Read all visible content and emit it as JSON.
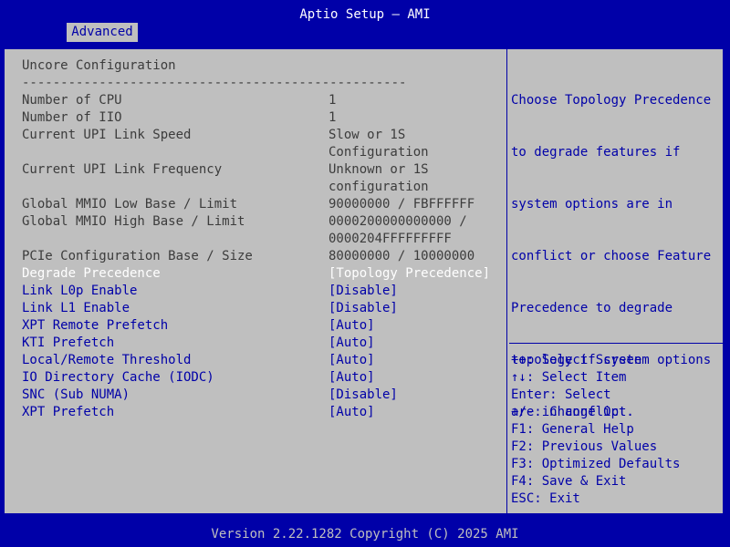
{
  "header": {
    "title": "Aptio Setup – AMI",
    "tab": "Advanced"
  },
  "section": {
    "title": "Uncore Configuration",
    "separator": "--------------------------------------------------"
  },
  "info_rows": [
    {
      "label": "Number of CPU",
      "value": "1"
    },
    {
      "label": "Number of IIO",
      "value": "1"
    },
    {
      "label": "Current UPI Link Speed",
      "value": "Slow or 1S",
      "value2": "Configuration"
    },
    {
      "label": "Current UPI Link Frequency",
      "value": "Unknown or 1S",
      "value2": "configuration"
    },
    {
      "label": "Global MMIO Low Base / Limit",
      "value": "90000000 / FBFFFFFF"
    },
    {
      "label": "Global MMIO High Base / Limit",
      "value": "0000200000000000 /",
      "value2": "0000204FFFFFFFFF"
    },
    {
      "label": "PCIe Configuration Base / Size",
      "value": "80000000 / 10000000"
    }
  ],
  "options": [
    {
      "label": "Degrade Precedence",
      "value": "[Topology Precedence]"
    },
    {
      "label": "Link L0p Enable",
      "value": "[Disable]"
    },
    {
      "label": "Link L1 Enable",
      "value": "[Disable]"
    },
    {
      "label": "XPT Remote Prefetch",
      "value": "[Auto]"
    },
    {
      "label": "KTI Prefetch",
      "value": "[Auto]"
    },
    {
      "label": "Local/Remote Threshold",
      "value": "[Auto]"
    },
    {
      "label": "IO Directory Cache (IODC)",
      "value": "[Auto]"
    },
    {
      "label": "SNC (Sub NUMA)",
      "value": "[Disable]"
    },
    {
      "label": "XPT Prefetch",
      "value": "[Auto]"
    }
  ],
  "help": {
    "lines": [
      "Choose Topology Precedence",
      "to degrade features if",
      "system options are in",
      "conflict or choose Feature",
      "Precedence to degrade",
      "topology if system options",
      "are in conflict."
    ]
  },
  "keys": [
    "++: Select Screen",
    "↑↓: Select Item",
    "Enter: Select",
    "+/-: Change Opt.",
    "F1: General Help",
    "F2: Previous Values",
    "F3: Optimized Defaults",
    "F4: Save & Exit",
    "ESC: Exit"
  ],
  "footer": {
    "text": "Version 2.22.1282 Copyright (C) 2025 AMI"
  },
  "colors": {
    "background": "#0000a8",
    "panel": "#bfbfbf",
    "link": "#0000a8",
    "selected": "#ffffff",
    "text": "#3c3c3c"
  }
}
